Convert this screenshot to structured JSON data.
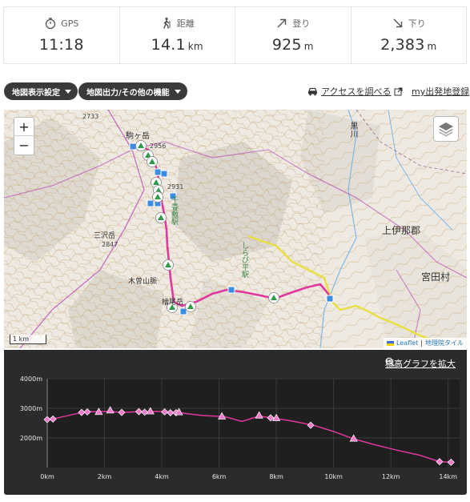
{
  "stats": [
    {
      "key": "gps",
      "label": "GPS",
      "value": "11:18",
      "unit": "",
      "icon": "stopwatch-icon"
    },
    {
      "key": "distance",
      "label": "距離",
      "value": "14.1",
      "unit": "km",
      "icon": "hiker-icon"
    },
    {
      "key": "ascent",
      "label": "登り",
      "value": "925",
      "unit": "m",
      "icon": "arrow-up-right-icon"
    },
    {
      "key": "descent",
      "label": "下り",
      "value": "2,383",
      "unit": "m",
      "icon": "arrow-down-right-icon"
    }
  ],
  "toolbar": {
    "map_display_settings": "地図表示設定",
    "map_output_other": "地図出力/その他の機能",
    "access_link": "アクセスを調べる",
    "my_trailhead": "my出発地登録"
  },
  "map": {
    "zoom_in": "+",
    "zoom_out": "−",
    "scale_label": "1 km",
    "attribution_leaflet": "Leaflet",
    "attribution_sep": "|",
    "attribution_gsi": "地理院タイル",
    "labels": {
      "komagatake": "駒ヶ岳",
      "inagun": "上伊那郡",
      "miyadamura": "宮田村",
      "mitsuzake": "三沢岳",
      "kisosanmyaku": "木曽山脈",
      "hinokiodake": "檜尾岳",
      "ropeway1": "千畳敷駅",
      "ropeway2": "しらび平駅",
      "kurokawa": "黒川",
      "elev_2733": "2733",
      "elev_2956": "2956",
      "elev_2847": "2847",
      "elev_2931": "2931"
    },
    "icons": {
      "summit": "summit-marker-icon",
      "hut": "hut-marker-icon",
      "layers": "layers-icon"
    }
  },
  "elevation": {
    "expand_label": "標高グラフを拡大",
    "route_color": "#e0389c",
    "chart_data": {
      "type": "line",
      "xlabel": "",
      "ylabel": "",
      "x_unit": "km",
      "y_unit": "m",
      "xlim": [
        0,
        14.4
      ],
      "ylim": [
        1000,
        4000
      ],
      "x_ticks": [
        "0km",
        "2km",
        "4km",
        "6km",
        "8km",
        "10km",
        "12km",
        "14km"
      ],
      "y_ticks": [
        "2000m",
        "3000m",
        "4000m"
      ],
      "series": [
        {
          "x": [
            0,
            0.2,
            1.2,
            1.4,
            2.2,
            2.6,
            3.2,
            3.4,
            3.8,
            4.2,
            4.4,
            4.6,
            4.9,
            5.4,
            6.2,
            6.8,
            7.4,
            7.8,
            8.1,
            8.6,
            9.3,
            10.0,
            10.7,
            11.4,
            12.2,
            13.0,
            13.7,
            14.1
          ],
          "y": [
            2620,
            2640,
            2860,
            2880,
            2900,
            2860,
            2890,
            2870,
            2900,
            2880,
            2840,
            2860,
            2820,
            2760,
            2720,
            2560,
            2740,
            2680,
            2640,
            2560,
            2430,
            2220,
            1970,
            1780,
            1590,
            1420,
            1200,
            1180
          ]
        }
      ],
      "markers": [
        {
          "x": 0.0,
          "y": 2620,
          "shape": "diamond"
        },
        {
          "x": 0.2,
          "y": 2640,
          "shape": "diamond"
        },
        {
          "x": 1.2,
          "y": 2860,
          "shape": "diamond"
        },
        {
          "x": 1.4,
          "y": 2880,
          "shape": "diamond"
        },
        {
          "x": 1.8,
          "y": 2870,
          "shape": "triangle"
        },
        {
          "x": 2.2,
          "y": 2920,
          "shape": "triangle"
        },
        {
          "x": 2.6,
          "y": 2860,
          "shape": "diamond"
        },
        {
          "x": 3.2,
          "y": 2890,
          "shape": "diamond"
        },
        {
          "x": 3.4,
          "y": 2870,
          "shape": "diamond"
        },
        {
          "x": 3.6,
          "y": 2890,
          "shape": "triangle"
        },
        {
          "x": 4.1,
          "y": 2880,
          "shape": "diamond"
        },
        {
          "x": 4.3,
          "y": 2850,
          "shape": "diamond"
        },
        {
          "x": 4.5,
          "y": 2850,
          "shape": "diamond"
        },
        {
          "x": 4.6,
          "y": 2860,
          "shape": "triangle"
        },
        {
          "x": 6.1,
          "y": 2720,
          "shape": "triangle"
        },
        {
          "x": 7.4,
          "y": 2750,
          "shape": "triangle"
        },
        {
          "x": 7.8,
          "y": 2680,
          "shape": "diamond"
        },
        {
          "x": 8.0,
          "y": 2660,
          "shape": "triangle"
        },
        {
          "x": 9.2,
          "y": 2430,
          "shape": "diamond"
        },
        {
          "x": 10.7,
          "y": 1970,
          "shape": "triangle"
        },
        {
          "x": 13.7,
          "y": 1200,
          "shape": "diamond"
        },
        {
          "x": 14.1,
          "y": 1180,
          "shape": "diamond"
        }
      ]
    }
  }
}
